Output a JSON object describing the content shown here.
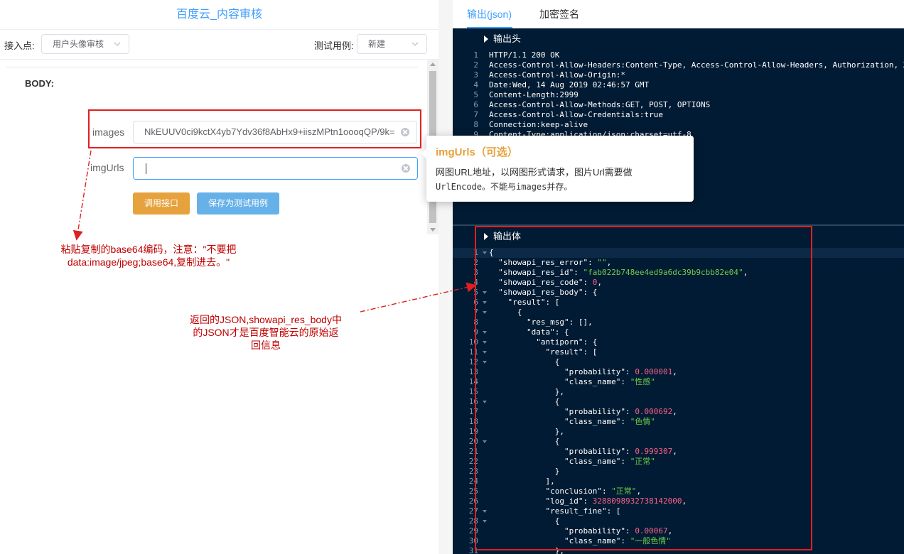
{
  "left": {
    "title": "百度云_内容审核",
    "entry_label": "接入点:",
    "entry_value": "用户头像审核",
    "test_label": "测试用例:",
    "test_value": "新建",
    "body_label": "BODY:",
    "images_label": "images",
    "images_value": "NkEUUV0ci9kctX4yb7Ydv36f8AbHx9+iiszMPtn1oooqQP/9k=",
    "imgurls_label": "imgUrls",
    "imgurls_value": "",
    "call_button": "调用接口",
    "save_button": "保存为测试用例"
  },
  "annotations": {
    "left_note_line1": "粘贴复制的base64编码，注意：\"不要把",
    "left_note_line2": "data:image/jpeg;base64,复制进去。\"",
    "right_note_line1": "返回的JSON,showapi_res_body中",
    "right_note_line2": "的JSON才是百度智能云的原始返",
    "right_note_line3": "回信息"
  },
  "tooltip": {
    "title": "imgUrls（可选）",
    "line1": "网图URL地址，以网图形式请求，图片Url需要做",
    "line2": "UrlEncode。不能与images并存。"
  },
  "right": {
    "tab_output": "输出(json)",
    "tab_sign": "加密签名",
    "header_section": "输出头",
    "body_section": "输出体",
    "header_lines": [
      "HTTP/1.1 200 OK",
      "Access-Control-Allow-Headers:Content-Type, Access-Control-Allow-Headers, Authorization, X",
      "Access-Control-Allow-Origin:*",
      "Date:Wed, 14 Aug 2019 02:46:57 GMT",
      "Content-Length:2999",
      "Access-Control-Allow-Methods:GET, POST, OPTIONS",
      "Access-Control-Allow-Credentials:true",
      "Connection:keep-alive",
      "Content-Type:application/json;charset=utf-8"
    ],
    "body_lines": [
      [
        {
          "t": "{"
        }
      ],
      [
        {
          "t": "  \"showapi_res_error\": "
        },
        {
          "t": "\"\"",
          "c": "s"
        },
        {
          "t": ","
        }
      ],
      [
        {
          "t": "  \"showapi_res_id\": "
        },
        {
          "t": "\"fab022b748ee4ed9a6dc39b9cbb82e04\"",
          "c": "s"
        },
        {
          "t": ","
        }
      ],
      [
        {
          "t": "  \"showapi_res_code\": "
        },
        {
          "t": "0",
          "c": "n"
        },
        {
          "t": ","
        }
      ],
      [
        {
          "t": "  \"showapi_res_body\": {"
        }
      ],
      [
        {
          "t": "    \"result\": ["
        }
      ],
      [
        {
          "t": "      {"
        }
      ],
      [
        {
          "t": "        \"res_msg\": [],"
        }
      ],
      [
        {
          "t": "        \"data\": {"
        }
      ],
      [
        {
          "t": "          \"antiporn\": {"
        }
      ],
      [
        {
          "t": "            \"result\": ["
        }
      ],
      [
        {
          "t": "              {"
        }
      ],
      [
        {
          "t": "                \"probability\": "
        },
        {
          "t": "0.000001",
          "c": "n"
        },
        {
          "t": ","
        }
      ],
      [
        {
          "t": "                \"class_name\": "
        },
        {
          "t": "\"性感\"",
          "c": "s"
        }
      ],
      [
        {
          "t": "              },"
        }
      ],
      [
        {
          "t": "              {"
        }
      ],
      [
        {
          "t": "                \"probability\": "
        },
        {
          "t": "0.000692",
          "c": "n"
        },
        {
          "t": ","
        }
      ],
      [
        {
          "t": "                \"class_name\": "
        },
        {
          "t": "\"色情\"",
          "c": "s"
        }
      ],
      [
        {
          "t": "              },"
        }
      ],
      [
        {
          "t": "              {"
        }
      ],
      [
        {
          "t": "                \"probability\": "
        },
        {
          "t": "0.999307",
          "c": "n"
        },
        {
          "t": ","
        }
      ],
      [
        {
          "t": "                \"class_name\": "
        },
        {
          "t": "\"正常\"",
          "c": "s"
        }
      ],
      [
        {
          "t": "              }"
        }
      ],
      [
        {
          "t": "            ],"
        }
      ],
      [
        {
          "t": "            \"conclusion\": "
        },
        {
          "t": "\"正常\"",
          "c": "s"
        },
        {
          "t": ","
        }
      ],
      [
        {
          "t": "            \"log_id\": "
        },
        {
          "t": "3288098932738142000",
          "c": "n"
        },
        {
          "t": ","
        }
      ],
      [
        {
          "t": "            \"result_fine\": ["
        }
      ],
      [
        {
          "t": "              {"
        }
      ],
      [
        {
          "t": "                \"probability\": "
        },
        {
          "t": "0.00067",
          "c": "n"
        },
        {
          "t": ","
        }
      ],
      [
        {
          "t": "                \"class_name\": "
        },
        {
          "t": "\"一般色情\"",
          "c": "s"
        }
      ],
      [
        {
          "t": "              },"
        }
      ]
    ],
    "body_fold_lines": [
      1,
      5,
      6,
      7,
      9,
      10,
      11,
      12,
      16,
      20,
      27,
      28
    ]
  }
}
